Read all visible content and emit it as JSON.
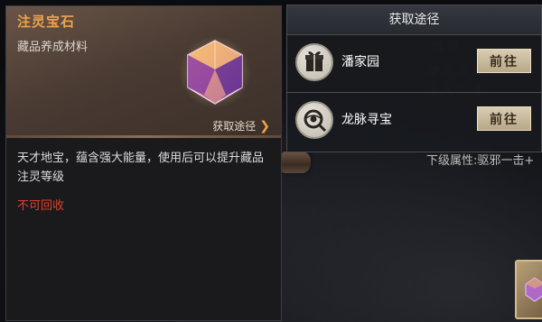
{
  "item": {
    "name": "注灵宝石",
    "type": "藏品养成材料",
    "source_link": "获取途径",
    "description": "天才地宝，蕴含强大能量，使用后可以提升藏品注灵等级",
    "warning": "不可回收",
    "icon": "gem-icon"
  },
  "source_panel": {
    "title": "获取途径",
    "sources": [
      {
        "name": "潘家园",
        "button": "前往",
        "icon": "gift-box-icon"
      },
      {
        "name": "龙脉寻宝",
        "button": "前往",
        "icon": "compass-eye-icon"
      }
    ]
  },
  "background": {
    "next_attr": "下级属性:驱邪一击+"
  },
  "colors": {
    "name_accent": "#f0a34a",
    "warning": "#e0402f",
    "button_bg": "#d9ccb3"
  }
}
